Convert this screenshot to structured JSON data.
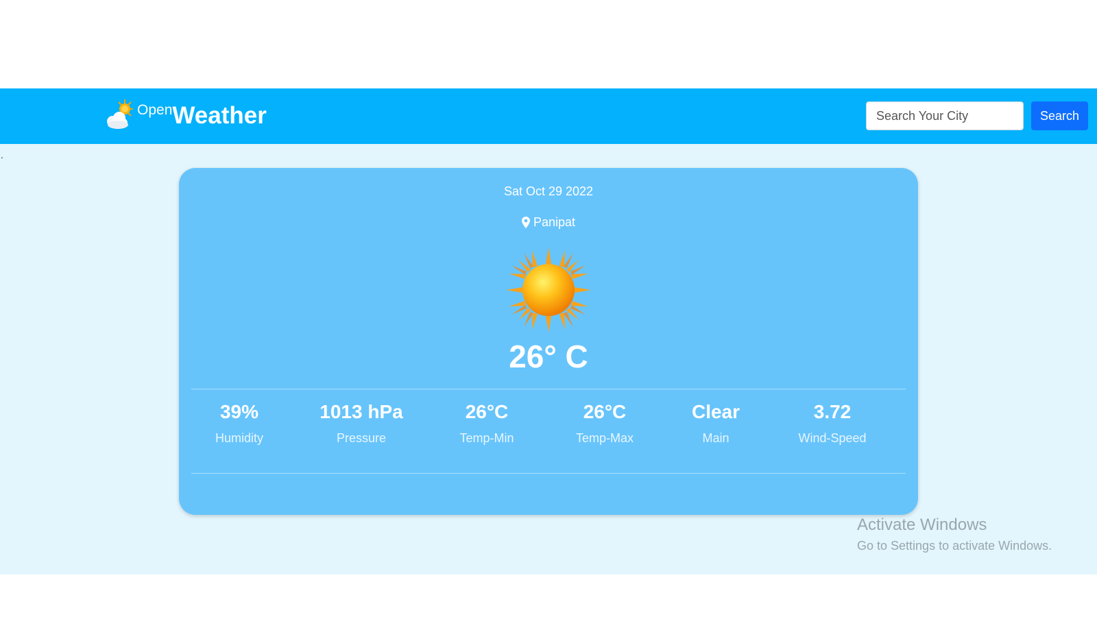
{
  "header": {
    "brand_small": "Open",
    "brand_big": "Weather",
    "logo_icon": "sun-cloud-icon",
    "search": {
      "placeholder": "Search Your City",
      "value": ""
    },
    "search_button_label": "Search"
  },
  "main": {
    "stray_text": ".",
    "weather": {
      "date": "Sat Oct 29 2022",
      "location": "Panipat",
      "location_icon": "map-pin-icon",
      "condition_icon": "sun-icon",
      "temperature": "26° C",
      "stats": [
        {
          "value": "39%",
          "label": "Humidity"
        },
        {
          "value": "1013 hPa",
          "label": "Pressure"
        },
        {
          "value": "26°C",
          "label": "Temp-Min"
        },
        {
          "value": "26°C",
          "label": "Temp-Max"
        },
        {
          "value": "Clear",
          "label": "Main"
        },
        {
          "value": "3.72",
          "label": "Wind-Speed"
        }
      ]
    }
  },
  "watermark": {
    "title": "Activate Windows",
    "subtitle": "Go to Settings to activate Windows."
  },
  "colors": {
    "navbar": "#03b1fc",
    "page_background": "#e3f6fd",
    "card": "#67c4fb",
    "button": "#0d6efd"
  }
}
